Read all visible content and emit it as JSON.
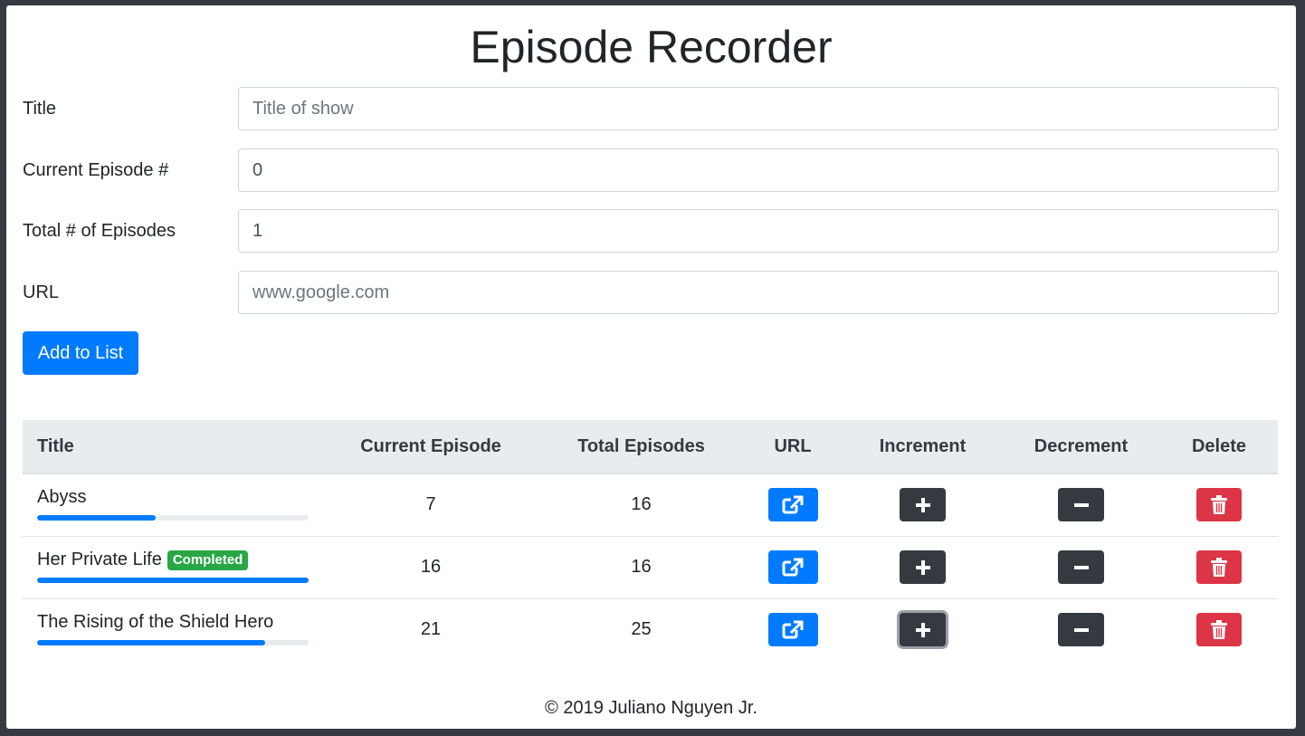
{
  "header": {
    "title": "Episode Recorder"
  },
  "form": {
    "title": {
      "label": "Title",
      "placeholder": "Title of show",
      "value": ""
    },
    "current": {
      "label": "Current Episode #",
      "value": "0"
    },
    "total": {
      "label": "Total # of Episodes",
      "value": "1"
    },
    "url": {
      "label": "URL",
      "placeholder": "www.google.com",
      "value": ""
    },
    "add_label": "Add to List"
  },
  "table": {
    "headers": [
      "Title",
      "Current Episode",
      "Total Episodes",
      "URL",
      "Increment",
      "Decrement",
      "Delete"
    ],
    "rows": [
      {
        "title": "Abyss",
        "current": "7",
        "total": "16",
        "badge": "",
        "progress": 0.4375
      },
      {
        "title": "Her Private Life",
        "current": "16",
        "total": "16",
        "badge": "Completed",
        "progress": 1.0
      },
      {
        "title": "The Rising of the Shield Hero",
        "current": "21",
        "total": "25",
        "badge": "",
        "progress": 0.84
      }
    ],
    "icons": {
      "url": "external-link-icon",
      "increment": "plus-icon",
      "decrement": "minus-icon",
      "delete": "trash-icon"
    }
  },
  "footer": {
    "text": "© 2019 Juliano Nguyen Jr."
  },
  "colors": {
    "background": "#343a40",
    "primary": "#007bff",
    "dark": "#343a40",
    "danger": "#dc3545",
    "success": "#28a745"
  }
}
